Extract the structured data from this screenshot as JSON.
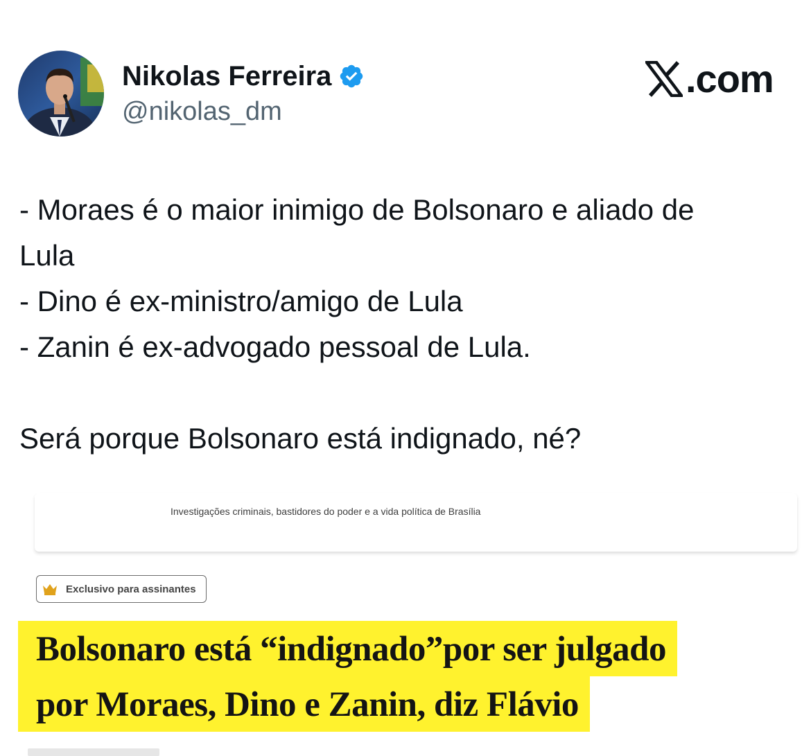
{
  "author": {
    "name": "Nikolas Ferreira",
    "handle": "@nikolas_dm",
    "verified": true,
    "verified_color": "#1d9bf0"
  },
  "brand": {
    "icon": "x-logo-icon",
    "text": ".com"
  },
  "tweet": {
    "lines": [
      "- Moraes é o maior inimigo de Bolsonaro e aliado de",
      "Lula",
      "- Dino é ex-ministro/amigo de Lula",
      "- Zanin é ex-advogado pessoal de Lula.",
      "Será porque Bolsonaro está indignado, né?"
    ]
  },
  "article": {
    "tagline": "Investigações criminais, bastidores do poder e a vida política de Brasília",
    "badge": {
      "icon": "crown-icon",
      "label": "Exclusivo para assinantes"
    },
    "headline_lines": [
      "Bolsonaro está “indignado”por ser julgado",
      "por Moraes, Dino e Zanin, diz Flávio"
    ],
    "highlight_color": "#fff22e"
  },
  "colors": {
    "text_primary": "#0f1419",
    "text_secondary": "#536471"
  }
}
